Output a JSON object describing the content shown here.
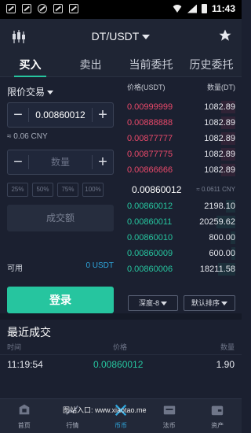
{
  "statusbar": {
    "time": "11:43"
  },
  "appbar": {
    "pair": "DT/USDT"
  },
  "tabs": [
    "买入",
    "卖出",
    "当前委托",
    "历史委托"
  ],
  "form": {
    "order_type": "限价交易",
    "price_value": "0.00860012",
    "cny": "≈ 0.06 CNY",
    "qty_placeholder": "数量",
    "percents": [
      "25%",
      "50%",
      "75%",
      "100%"
    ],
    "amount_label": "成交额",
    "available_label": "可用",
    "available_value": "0 USDT",
    "login_label": "登录"
  },
  "book": {
    "price_header": "价格(USDT)",
    "qty_header": "数量(DT)",
    "asks": [
      {
        "price": "0.00999999",
        "qty": "1082.89"
      },
      {
        "price": "0.00888888",
        "qty": "1082.89"
      },
      {
        "price": "0.00877777",
        "qty": "1082.89"
      },
      {
        "price": "0.00877775",
        "qty": "1082.89"
      },
      {
        "price": "0.00866666",
        "qty": "1082.89"
      }
    ],
    "last_price": "0.00860012",
    "last_cny": "≈ 0.0611 CNY",
    "bids": [
      {
        "price": "0.00860012",
        "qty": "2198.10"
      },
      {
        "price": "0.00860011",
        "qty": "20259.62"
      },
      {
        "price": "0.00860010",
        "qty": "800.00"
      },
      {
        "price": "0.00860009",
        "qty": "600.00"
      },
      {
        "price": "0.00860006",
        "qty": "18211.58"
      }
    ],
    "depth_label": "深度-8",
    "sort_label": "默认排序"
  },
  "trades": {
    "title": "最近成交",
    "headers": {
      "time": "时间",
      "price": "价格",
      "qty": "数量"
    },
    "rows": [
      {
        "time": "11:19:54",
        "price": "0.00860012",
        "qty": "1.90"
      }
    ]
  },
  "nav": [
    "首页",
    "行情",
    "币币",
    "法币",
    "资产"
  ],
  "watermark": "图站入口: www.xiaotao.me",
  "colors": {
    "green": "#26c59f",
    "red": "#e9496a",
    "blue": "#2fa7de",
    "bg": "#1b2030"
  }
}
